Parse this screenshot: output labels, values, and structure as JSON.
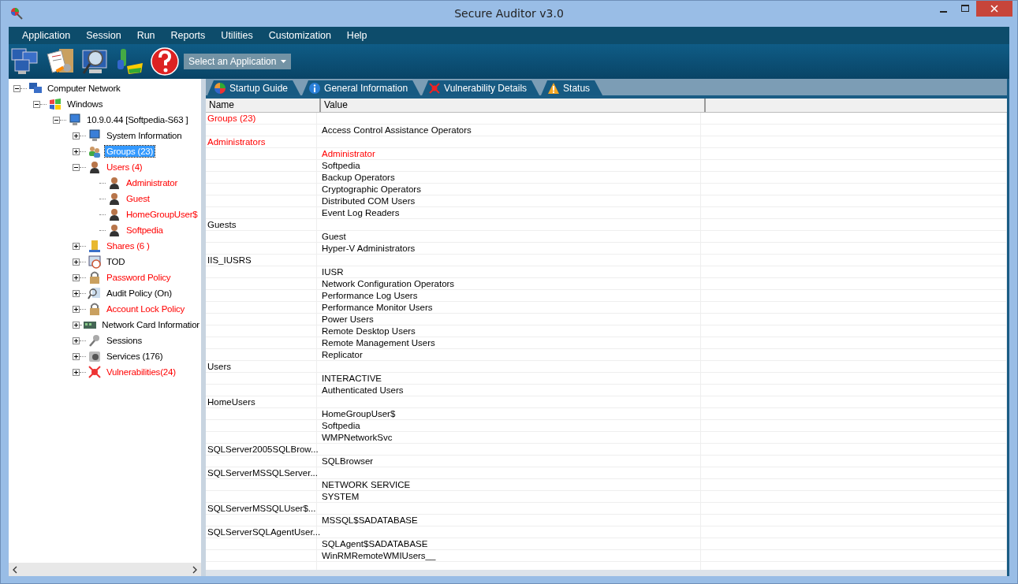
{
  "window": {
    "title": "Secure Auditor v3.0"
  },
  "menu": [
    "Application",
    "Session",
    "Run",
    "Reports",
    "Utilities",
    "Customization",
    "Help"
  ],
  "toolbar": {
    "app_select": {
      "value": "Select an Application"
    }
  },
  "tree": [
    {
      "label": "Computer Network",
      "expanded": true,
      "alert": false,
      "selected": false,
      "children": [
        {
          "label": "Windows",
          "expanded": true,
          "alert": false,
          "selected": false,
          "children": [
            {
              "label": "10.9.0.44 [Softpedia-S63 ]",
              "expanded": true,
              "alert": false,
              "selected": false,
              "children": [
                {
                  "label": "System Information",
                  "expanded": false,
                  "alert": false,
                  "selected": false
                },
                {
                  "label": "Groups (23)",
                  "expanded": false,
                  "alert": false,
                  "selected": true
                },
                {
                  "label": "Users (4)",
                  "expanded": true,
                  "alert": true,
                  "selected": false,
                  "children": [
                    {
                      "label": "Administrator",
                      "alert": true,
                      "selected": false
                    },
                    {
                      "label": "Guest",
                      "alert": true,
                      "selected": false
                    },
                    {
                      "label": "HomeGroupUser$",
                      "alert": true,
                      "selected": false
                    },
                    {
                      "label": "Softpedia",
                      "alert": true,
                      "selected": false
                    }
                  ]
                },
                {
                  "label": "Shares (6 )",
                  "expanded": false,
                  "alert": true,
                  "selected": false
                },
                {
                  "label": "TOD",
                  "expanded": false,
                  "alert": false,
                  "selected": false
                },
                {
                  "label": "Password Policy",
                  "expanded": false,
                  "alert": true,
                  "selected": false
                },
                {
                  "label": "Audit Policy  (On)",
                  "expanded": false,
                  "alert": false,
                  "selected": false
                },
                {
                  "label": "Account Lock Policy",
                  "expanded": false,
                  "alert": true,
                  "selected": false
                },
                {
                  "label": "Network Card Informatior",
                  "expanded": false,
                  "alert": false,
                  "selected": false
                },
                {
                  "label": "Sessions",
                  "expanded": false,
                  "alert": false,
                  "selected": false
                },
                {
                  "label": "Services (176)",
                  "expanded": false,
                  "alert": false,
                  "selected": false
                },
                {
                  "label": "Vulnerabilities(24)",
                  "expanded": false,
                  "alert": true,
                  "selected": false
                }
              ]
            }
          ]
        }
      ]
    }
  ],
  "tabs": [
    {
      "label": "Startup Guide",
      "selected": false
    },
    {
      "label": "General Information",
      "selected": false
    },
    {
      "label": "Vulnerability Details",
      "selected": false
    },
    {
      "label": "Status",
      "selected": false
    }
  ],
  "table": {
    "columns": [
      "Name",
      "Value"
    ],
    "rows": [
      {
        "name": "Groups (23)",
        "value": "",
        "alert": true
      },
      {
        "name": "",
        "value": "Access Control Assistance Operators",
        "alert": false
      },
      {
        "name": "Administrators",
        "value": "",
        "alert": true
      },
      {
        "name": "",
        "value": "Administrator",
        "alert": true
      },
      {
        "name": "",
        "value": "Softpedia",
        "alert": false
      },
      {
        "name": "",
        "value": "Backup Operators",
        "alert": false
      },
      {
        "name": "",
        "value": "Cryptographic Operators",
        "alert": false
      },
      {
        "name": "",
        "value": "Distributed COM Users",
        "alert": false
      },
      {
        "name": "",
        "value": "Event Log Readers",
        "alert": false
      },
      {
        "name": "Guests",
        "value": "",
        "alert": false
      },
      {
        "name": "",
        "value": "Guest",
        "alert": false
      },
      {
        "name": "",
        "value": "Hyper-V Administrators",
        "alert": false
      },
      {
        "name": "IIS_IUSRS",
        "value": "",
        "alert": false
      },
      {
        "name": "",
        "value": "IUSR",
        "alert": false
      },
      {
        "name": "",
        "value": "Network Configuration Operators",
        "alert": false
      },
      {
        "name": "",
        "value": "Performance Log Users",
        "alert": false
      },
      {
        "name": "",
        "value": "Performance Monitor Users",
        "alert": false
      },
      {
        "name": "",
        "value": "Power Users",
        "alert": false
      },
      {
        "name": "",
        "value": "Remote Desktop Users",
        "alert": false
      },
      {
        "name": "",
        "value": "Remote Management Users",
        "alert": false
      },
      {
        "name": "",
        "value": "Replicator",
        "alert": false
      },
      {
        "name": "Users",
        "value": "",
        "alert": false
      },
      {
        "name": "",
        "value": "INTERACTIVE",
        "alert": false
      },
      {
        "name": "",
        "value": "Authenticated Users",
        "alert": false
      },
      {
        "name": "HomeUsers",
        "value": "",
        "alert": false
      },
      {
        "name": "",
        "value": "HomeGroupUser$",
        "alert": false
      },
      {
        "name": "",
        "value": "Softpedia",
        "alert": false
      },
      {
        "name": "",
        "value": "WMPNetworkSvc",
        "alert": false
      },
      {
        "name": "SQLServer2005SQLBrow...",
        "value": "",
        "alert": false
      },
      {
        "name": "",
        "value": "SQLBrowser",
        "alert": false
      },
      {
        "name": "SQLServerMSSQLServer...",
        "value": "",
        "alert": false
      },
      {
        "name": "",
        "value": "NETWORK SERVICE",
        "alert": false
      },
      {
        "name": "",
        "value": "SYSTEM",
        "alert": false
      },
      {
        "name": "SQLServerMSSQLUser$...",
        "value": "",
        "alert": false
      },
      {
        "name": "",
        "value": "MSSQL$SADATABASE",
        "alert": false
      },
      {
        "name": "SQLServerSQLAgentUser...",
        "value": "",
        "alert": false
      },
      {
        "name": "",
        "value": "SQLAgent$SADATABASE",
        "alert": false
      },
      {
        "name": "",
        "value": "WinRMRemoteWMIUsers__",
        "alert": false
      }
    ]
  }
}
